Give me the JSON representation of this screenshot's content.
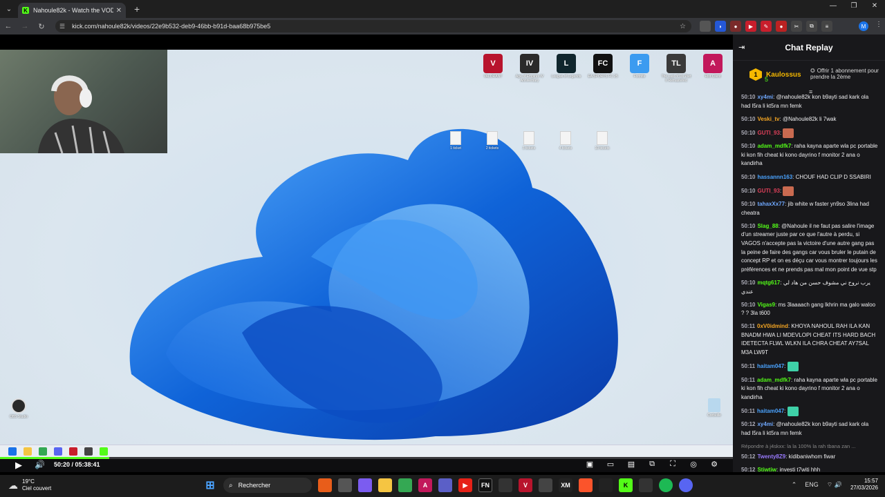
{
  "browser": {
    "tab_title": "Nahoule82k - Watch the VOD c",
    "tab_favicon": "K",
    "url": "kick.com/nahoule82k/videos/22e9b532-deb9-46bb-b91d-baa68b975be5",
    "profile_initial": "M"
  },
  "desktop": {
    "icons": [
      {
        "label": "VALORANT",
        "icon": "valorant-icon",
        "color": "#b8142d",
        "glyph": "V"
      },
      {
        "label": "Age of Empires IV Anniversary",
        "icon": "aoe-icon",
        "color": "#2a2a2a",
        "glyph": "IV"
      },
      {
        "label": "League of Legends",
        "icon": "lol-icon",
        "color": "#10262d",
        "glyph": "L"
      },
      {
        "label": "EA SPORTS FC 25",
        "icon": "fc25-icon",
        "color": "#111111",
        "glyph": "FC"
      },
      {
        "label": "Fortnite",
        "icon": "fortnite-icon",
        "color": "#3b9bf0",
        "glyph": "F"
      },
      {
        "label": "The Last of Us Part II Remastered",
        "icon": "tlou-icon",
        "color": "#3a3a3a",
        "glyph": "TL"
      },
      {
        "label": "Riot Client",
        "icon": "riot-icon",
        "color": "#c2185b",
        "glyph": "A"
      }
    ],
    "files": [
      "1 ticket",
      "2 tickets",
      "3 tickets",
      "4 tickets",
      "10 tickets"
    ],
    "obs_label": "OBS Studio",
    "bin_label": "Corbeille"
  },
  "player": {
    "time": "50:20 / 05:38:41",
    "progress": 0.149
  },
  "chat": {
    "title": "Chat Replay",
    "gift": {
      "rank": "1",
      "user": "Kaulossus",
      "count": "5",
      "text": "Offrir 1 abonnement pour prendre la 2ème"
    },
    "messages": [
      {
        "time": "50:10",
        "user": "xy4mi",
        "color": "#6fa8ff",
        "text": "@nahoule82k kon b9ayti sad kark ola had l5ra li kt5ra mn femk"
      },
      {
        "time": "50:10",
        "user": "Veski_tv",
        "color": "#f5a623",
        "text": "@Nahoule82k li 7wak"
      },
      {
        "time": "50:10",
        "user": "GUTI_93",
        "color": "#e0405a",
        "text": "",
        "emote": "#c96a50"
      },
      {
        "time": "50:10",
        "user": "adam_mdfk7",
        "color": "#53fc18",
        "text": "raha kayna aparte wla pc portable ki kon fih cheat ki kono dayrino f monitor 2 ana o kandirha"
      },
      {
        "time": "50:10",
        "user": "hassannn163",
        "color": "#4aa3ff",
        "text": "CHOUF HAD CLIP D SSABIRI"
      },
      {
        "time": "50:10",
        "user": "GUTI_93",
        "color": "#e0405a",
        "text": "",
        "emote": "#c96a50"
      },
      {
        "time": "50:10",
        "user": "tahaxXx77",
        "color": "#6fa8ff",
        "text": "jib white w faster yn9so 3lina had cheatra"
      },
      {
        "time": "50:10",
        "user": "Slag_88",
        "color": "#53fc18",
        "text": "@Nahoule il ne faut pas salire l'image d'un streamer juste par ce que l'autre à perdu, si VAGOS n'accepte pas la victoire d'une autre gang pas la peine de faire des gangs car vous bruler le putain de concept RP et on es déçu car vous montrer toujours les préférences et ne prends pas mal mon point de vue stp"
      },
      {
        "time": "50:10",
        "user": "mqtg617",
        "color": "#53fc18",
        "text": "يرب نروح ني مشوف حسن من هاد لي عندي"
      },
      {
        "time": "50:10",
        "user": "Vigas9",
        "color": "#53fc18",
        "text": "ms 3laaaach gang lkhrin ma galo waloo ? ? 3la t600"
      },
      {
        "time": "50:11",
        "user": "0xV0idmind",
        "color": "#f5a623",
        "text": "KHOYA NAHOUL RAH ILA KAN BNADM HWA LI MDEVLOPI CHEAT ITS HARD BACH IDETECTA FLWL WLKN ILA CHRA CHEAT AY7SAL M3A LW9T"
      },
      {
        "time": "50:11",
        "user": "haitam047",
        "color": "#4aa3ff",
        "text": "",
        "emote": "#3fd1a8"
      },
      {
        "time": "50:11",
        "user": "adam_mdfk7",
        "color": "#53fc18",
        "text": "raha kayna aparte wla pc portable ki kon fih cheat ki kono dayrino f monitor 2 ana o kandirha"
      },
      {
        "time": "50:11",
        "user": "haitam047",
        "color": "#4aa3ff",
        "text": "",
        "emote": "#3fd1a8"
      },
      {
        "time": "50:12",
        "user": "xy4mi",
        "color": "#6fa8ff",
        "text": "@nahoule82k kon b9ayti sad kark ola had l5ra li kt5ra mn femk"
      },
      {
        "reply": "Répondre à j4skxx: la la 100% la rah tbana zan ..."
      },
      {
        "time": "50:12",
        "user": "Twenty8Z9",
        "color": "#9a7bff",
        "text": "kidibaniwhom fiwar"
      },
      {
        "time": "50:12",
        "user": "Stiwtiw",
        "color": "#53fc18",
        "text": "investi t7witi hhh"
      }
    ]
  },
  "taskbar": {
    "weather_temp": "19°C",
    "weather_desc": "Ciel couvert",
    "search_label": "Rechercher",
    "lang": "ENG",
    "time": "15:57",
    "date": "27/03/2026"
  }
}
